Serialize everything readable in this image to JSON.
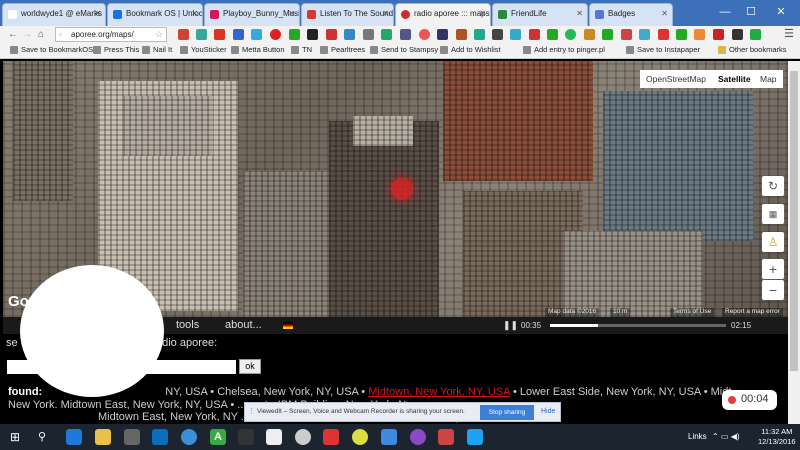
{
  "tabs": [
    {
      "title": "worldwyde1 @ eMarks",
      "color": "#ffffff"
    },
    {
      "title": "Bookmark OS | Unlock",
      "color": "#1a73d9"
    },
    {
      "title": "Playboy_Bunny_Music_",
      "color": "#d01a5c"
    },
    {
      "title": "Listen To The Sounds O",
      "color": "#d03a3a"
    },
    {
      "title": "radio aporee ::: maps",
      "color": "#d02a2a",
      "active": true
    },
    {
      "title": "FriendLife",
      "color": "#2a8a3a"
    },
    {
      "title": "Badges",
      "color": "#5577cc"
    }
  ],
  "window_controls": {
    "minimize": "—",
    "maximize": "☐",
    "close": "✕"
  },
  "toolbar": {
    "url": "aporee.org/maps/"
  },
  "bookmarks": [
    "Save to BookmarkOS",
    "Press This",
    "Nail It",
    "YouSticker",
    "Metta Button",
    "TN",
    "Pearltrees",
    "Send to Stampsy",
    "Add to Wishlist",
    "Add entry to pinger.pl",
    "Save to Instapaper",
    "Other bookmarks"
  ],
  "map": {
    "types": [
      "OpenStreetMap",
      "Satellite",
      "Map"
    ],
    "selected_type": "Satellite",
    "zoom_in": "+",
    "zoom_out": "−",
    "legal": {
      "data": "Map data ©2016",
      "scale": "10 m",
      "terms": "Terms of Use",
      "report": "Report a map error"
    },
    "logo": "Go"
  },
  "navstrip": {
    "tools": "tools",
    "about": "about...",
    "time_elapsed": "00:35",
    "time_total": "02:15",
    "progress": 0.27
  },
  "search": {
    "label_left": "se",
    "label_right": "adio aporee:",
    "ok_label": "ok",
    "input_value": ""
  },
  "found": {
    "label": "found:",
    "line1_a": "NY, USA • Chelsea, New York, NY, USA •",
    "line1_highlight": "Midtown, New York, NY, USA",
    "line1_b": "• Lower East Side, New York, NY, USA • Midt",
    "line2": "New York.  Midtown East, New York, NY, USA • ...  ...ot • IBM Building, New York, N",
    "line3": "Midtown East, New York, NY ...  thomas, 29.01.2016 14:15, more details...)"
  },
  "sharing": {
    "message": "ViewedIt – Screen, Voice and Webcam Recorder is sharing your screen.",
    "stop": "Stop sharing",
    "hide": "Hide"
  },
  "recorder": {
    "time": "00:04"
  },
  "taskbar": {
    "links": "Links",
    "time": "11:32 AM",
    "date": "12/13/2016"
  }
}
